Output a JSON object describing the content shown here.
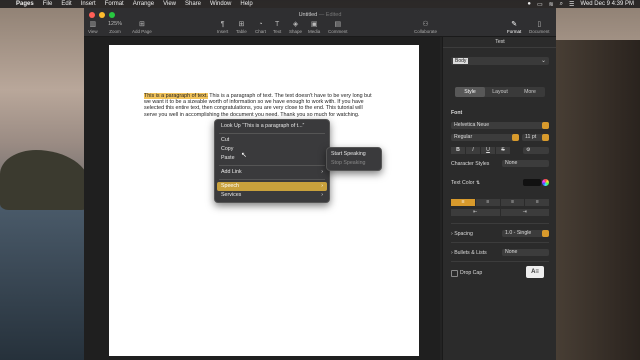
{
  "menubar": {
    "apple_icon": "apple-icon",
    "items": [
      "Pages",
      "File",
      "Edit",
      "Insert",
      "Format",
      "Arrange",
      "View",
      "Share",
      "Window",
      "Help"
    ],
    "clock": "Wed Dec 9  4:39 PM"
  },
  "window": {
    "title": "Untitled",
    "title_sep": " — ",
    "title_status": "Edited"
  },
  "toolbar": {
    "view": "View",
    "zoom": "125%",
    "zoom_label": "Zoom",
    "add_page": "Add Page",
    "insert": "Insert",
    "table": "Table",
    "chart": "Chart",
    "text": "Text",
    "shape": "Shape",
    "media": "Media",
    "comment": "Comment",
    "collaborate": "Collaborate",
    "format": "Format",
    "document": "Document"
  },
  "document": {
    "selected_text": "This is a paragraph of text.",
    "rest_text": " This is a paragraph of text. The text doesn't have to be very long but we want it to be a sizeable worth of information so we have enough to work with. If you have selected this entire text, then congratulations, you are very close to the end. This tutorial will serve you well in accomplishing the document you need. Thank you so much for watching."
  },
  "context_menu": {
    "look_up": "Look Up “This is a paragraph of t...”",
    "cut": "Cut",
    "copy": "Copy",
    "paste": "Paste",
    "add_link": "Add Link",
    "speech": "Speech",
    "services": "Services"
  },
  "speech_submenu": {
    "start": "Start Speaking",
    "stop": "Stop Speaking"
  },
  "inspector": {
    "tab": "Text",
    "paragraph_style": "Body",
    "segments": [
      "Style",
      "Layout",
      "More"
    ],
    "font_heading": "Font",
    "font_family": "Helvetica Neue",
    "font_weight": "Regular",
    "font_size": "11 pt",
    "bis": [
      "B",
      "I",
      "U",
      "S"
    ],
    "char_styles_label": "Character Styles",
    "char_styles_value": "None",
    "text_color_label": "Text Color",
    "text_color_value": "#111111",
    "align_icons": [
      "≡",
      "≡",
      "≡",
      "≡"
    ],
    "indent_icons": [
      "⇤",
      "⇥"
    ],
    "spacing_label": "Spacing",
    "spacing_value": "1.0 - Single",
    "bullets_label": "Bullets & Lists",
    "bullets_value": "None",
    "drop_cap_label": "Drop Cap"
  },
  "colors": {
    "accent": "#d89a2c",
    "selection": "#f2c35a"
  }
}
